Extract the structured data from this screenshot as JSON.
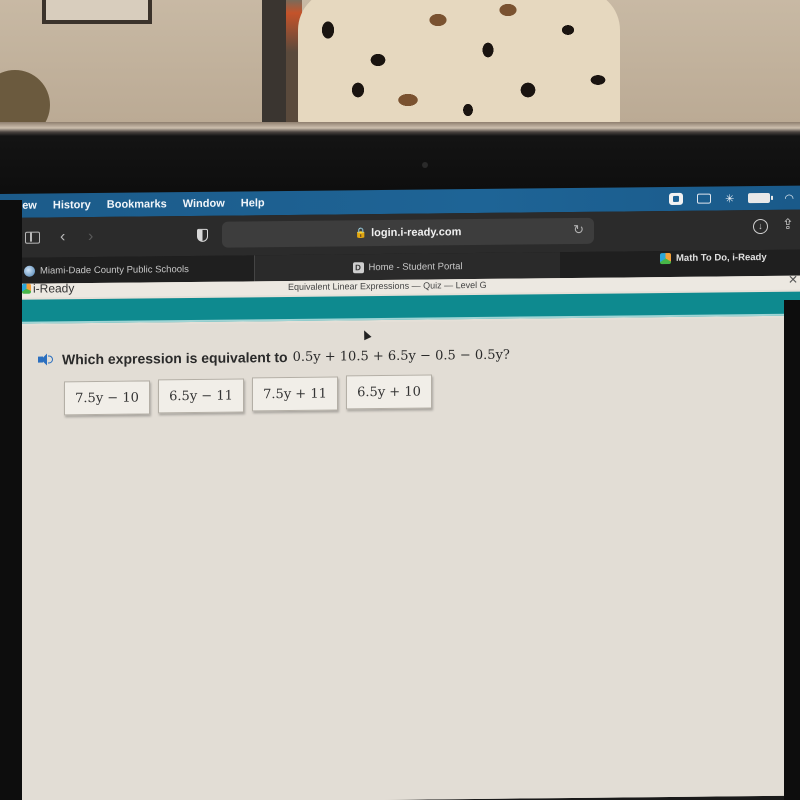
{
  "menubar": {
    "items": [
      "View",
      "History",
      "Bookmarks",
      "Window",
      "Help"
    ],
    "status_icons": [
      "zoom-icon",
      "keyboard-icon",
      "bluetooth-icon",
      "battery-icon",
      "wifi-icon"
    ],
    "bluetooth_glyph": "✳",
    "wifi_glyph": "◠"
  },
  "toolbar": {
    "back_glyph": "‹",
    "forward_glyph": "›",
    "lock_glyph": "🔒",
    "url": "login.i-ready.com",
    "reload_glyph": "↻",
    "download_glyph": "↓",
    "share_glyph": "⇪"
  },
  "tabs": [
    {
      "label": "Miami-Dade County Public Schools",
      "favicon": "globe-icon"
    },
    {
      "label": "Home - Student Portal",
      "favicon": "d-icon",
      "favicon_letter": "D"
    },
    {
      "label": "Math To Do, i-Ready",
      "favicon": "iready-cube-icon"
    }
  ],
  "app": {
    "logo": "i-Ready",
    "quiz_title": "Equivalent Linear Expressions — Quiz — Level G",
    "close_glyph": "✕",
    "accent_color": "#0e8a8f",
    "question": {
      "prompt": "Which expression is equivalent to",
      "expression": "0.5y + 10.5 + 6.5y − 0.5 − 0.5y?"
    },
    "answers": [
      "7.5y − 10",
      "6.5y − 11",
      "7.5y + 11",
      "6.5y + 10"
    ]
  }
}
